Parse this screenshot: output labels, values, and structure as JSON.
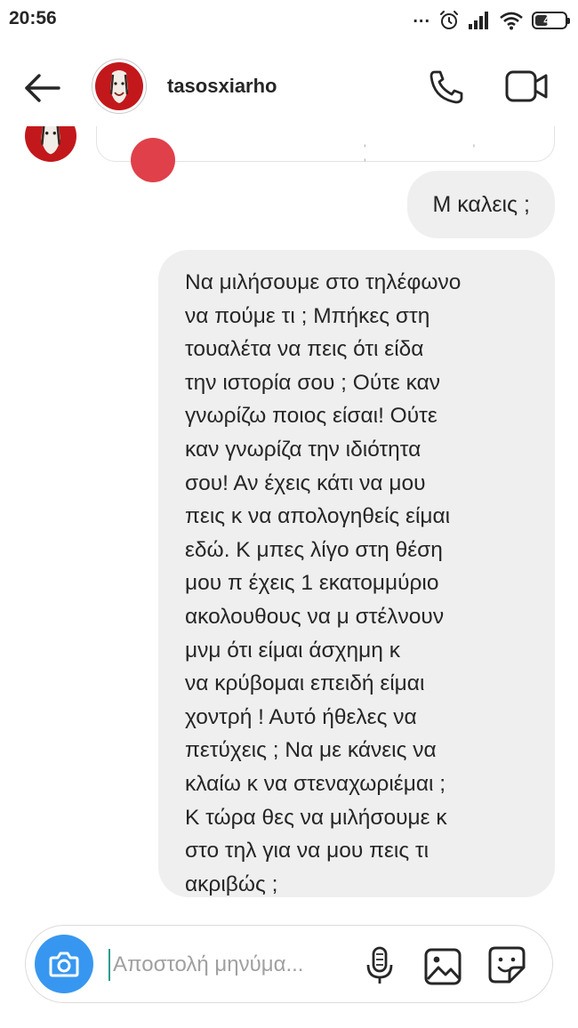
{
  "status_bar": {
    "time": "20:56",
    "dots": "...",
    "battery_percent": "44",
    "battery_level": 0.44,
    "icons": [
      "alarm-icon",
      "signal-icon",
      "wifi-icon",
      "battery-icon"
    ]
  },
  "header": {
    "username": "tasosxiarho",
    "icons": [
      "back-arrow-icon",
      "profile-avatar",
      "phone-icon",
      "video-camera-icon"
    ]
  },
  "messages": [
    {
      "direction": "sent",
      "lines": [
        "Μ καλεις ;"
      ]
    },
    {
      "direction": "sent",
      "lines": [
        "Να μιλήσουμε στο τηλέφωνο",
        "να πούμε τι ; Μπήκες στη",
        "τουαλέτα να πεις ότι είδα",
        "την ιστορία σου ; Ούτε καν",
        "γνωρίζω ποιος είσαι! Ούτε",
        "καν γνωρίζα την ιδιότητα",
        "σου! Αν έχεις κάτι να μου",
        "πεις κ να απολογηθείς είμαι",
        "εδώ. Κ μπες λίγο στη θέση",
        "μου π έχεις 1 εκατομμύριο",
        "ακολουθους να μ στέλνουν",
        "μνμ ότι είμαι άσχημη κ",
        "να κρύβομαι επειδή είμαι",
        "χοντρή ! Αυτό ήθελες να",
        "πετύχεις ; Να με κάνεις να",
        "κλαίω κ να στεναχωριέμαι ;",
        "Κ τώρα θες να μιλήσουμε κ",
        "στο τηλ για να μου πεις τι",
        "ακριβώς ;"
      ]
    }
  ],
  "composer": {
    "placeholder": "Αποστολή μηνύμα...",
    "value": "",
    "icons": [
      "camera-icon",
      "microphone-icon",
      "gallery-icon",
      "sticker-icon"
    ]
  },
  "colors": {
    "accent": "#3797f0",
    "bubble": "#efefef",
    "avatar": "#c2181c",
    "text": "#262626"
  }
}
